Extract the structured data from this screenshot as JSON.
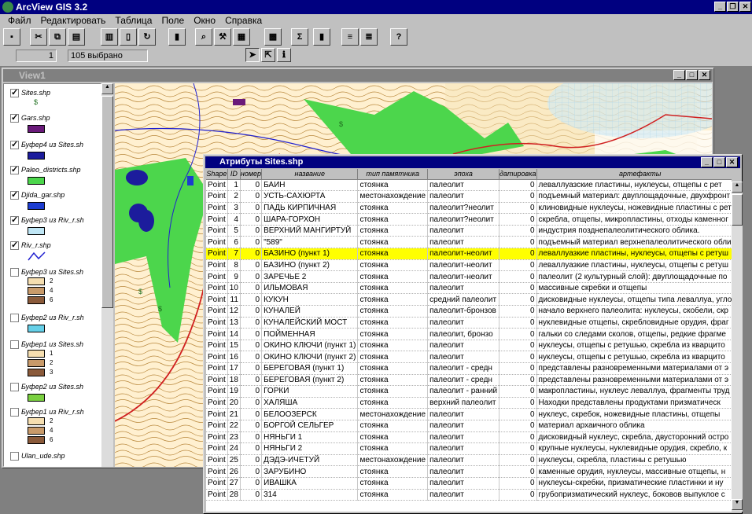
{
  "app": {
    "title": "ArcView GIS 3.2"
  },
  "menu": [
    "Файл",
    "Редактировать",
    "Таблица",
    "Поле",
    "Окно",
    "Справка"
  ],
  "status": {
    "selected_count": "1",
    "total_text": "105 выбрано"
  },
  "view": {
    "title": "View1"
  },
  "toc": [
    {
      "name": "Sites.shp",
      "checked": true
    },
    {
      "name": "Gars.shp",
      "checked": true,
      "color": "#6a1a7a"
    },
    {
      "name": "Буфер4 из Sites.sh",
      "checked": true,
      "color": "#1c1c9c"
    },
    {
      "name": "Paleo_districts.shp",
      "checked": true,
      "color": "#4cd64c"
    },
    {
      "name": "Djida_gar.shp",
      "checked": true,
      "color": "#1c3cd0"
    },
    {
      "name": "Буфер3 из Riv_r.sh",
      "checked": true,
      "color": "#bfe6f5"
    },
    {
      "name": "Riv_r.shp",
      "checked": true,
      "color": "#2020d0"
    },
    {
      "name": "Буфер3 из Sites.sh",
      "checked": false,
      "labels": [
        "2",
        "4",
        "6"
      ],
      "colors": [
        "#f5deb0",
        "#c89a6a",
        "#8a5a3a"
      ]
    },
    {
      "name": "Буфер2 из Riv_r.sh",
      "checked": false,
      "color": "#66d0e8"
    },
    {
      "name": "Буфер1 из Sites.sh",
      "checked": false,
      "labels": [
        "1",
        "2",
        "3"
      ],
      "colors": [
        "#f5deb0",
        "#c89a6a",
        "#8a5a3a"
      ]
    },
    {
      "name": "Буфер2 из Sites.sh",
      "checked": false,
      "color": "#7ad040"
    },
    {
      "name": "Буфер1 из Riv_r.sh",
      "checked": false,
      "labels": [
        "2",
        "4",
        "6"
      ],
      "colors": [
        "#f5deb0",
        "#c89a6a",
        "#8a5a3a"
      ]
    },
    {
      "name": "Ulan_ude.shp",
      "checked": false
    }
  ],
  "table": {
    "title": "Атрибуты Sites.shp",
    "columns": [
      "Shape",
      "ID",
      "номер",
      "название",
      "тип памятника",
      "эпоха",
      "датировка",
      "артефакты"
    ],
    "selected_index": 6,
    "rows": [
      [
        "Point",
        "1",
        "0",
        "БАИН",
        "стоянка",
        "палеолит",
        "0",
        "леваллуазские пластины, нуклеусы, отщепы с рет"
      ],
      [
        "Point",
        "2",
        "0",
        "УСТЬ-САХЮРТА",
        "местонахождение",
        "палеолит",
        "0",
        "подъемный материал: двуплощадочные, двухфронт"
      ],
      [
        "Point",
        "3",
        "0",
        "ПАДЬ КИРПИЧНАЯ",
        "стоянка",
        "палеолит?неолит",
        "0",
        "клиновидные нуклеусы, ножевидные пластины с ретуш"
      ],
      [
        "Point",
        "4",
        "0",
        "ШАРА-ГОРХОН",
        "стоянка",
        "палеолит?неолит",
        "0",
        "скребла, отщепы, микропластины, отходы каменног"
      ],
      [
        "Point",
        "5",
        "0",
        "ВЕРХНИЙ МАНГИРТУЙ",
        "стоянка",
        "палеолит",
        "0",
        "индустрия позднепалеолитического облика."
      ],
      [
        "Point",
        "6",
        "0",
        "\"589\"",
        "стоянка",
        "палеолит",
        "0",
        "подъемный материал верхнепалеолитического обли"
      ],
      [
        "Point",
        "7",
        "0",
        "БАЗИНО (пункт 1)",
        "стоянка",
        "палеолит-неолит",
        "0",
        "леваллуазкие пластины, нуклеусы, отщепы с ретуш"
      ],
      [
        "Point",
        "8",
        "0",
        "БАЗИНО (пункт 2)",
        "стоянка",
        "палеолит-неолит",
        "0",
        "леваллуазкие пластины, нуклеусы, отщепы с ретуш"
      ],
      [
        "Point",
        "9",
        "0",
        "ЗАРЕЧЬЕ 2",
        "стоянка",
        "палеолит-неолит",
        "0",
        "палеолит (2 культурный слой): двуплощадочные по"
      ],
      [
        "Point",
        "10",
        "0",
        "ИЛЬМОВАЯ",
        "стоянка",
        "палеолит",
        "0",
        "массивные скребки и отщепы"
      ],
      [
        "Point",
        "11",
        "0",
        "КУКУН",
        "стоянка",
        "средний палеолит",
        "0",
        "дисковидные нуклеусы, отщепы типа леваллуа, угло"
      ],
      [
        "Point",
        "12",
        "0",
        "КУНАЛЕЙ",
        "стоянка",
        "палеолит-бронзов",
        "0",
        "начало верхнего палеолита: нуклеусы, скобели, скр"
      ],
      [
        "Point",
        "13",
        "0",
        "КУНАЛЕЙСКИЙ МОСТ",
        "стоянка",
        "палеолит",
        "0",
        "нуклевидные отщепы, скребловидные орудия, фраг"
      ],
      [
        "Point",
        "14",
        "0",
        "ПОЙМЕННАЯ",
        "стоянка",
        "палеолит, бронзо",
        "0",
        "гальки со следами сколов, отщепы, редкие фрагме"
      ],
      [
        "Point",
        "15",
        "0",
        "ОКИНО КЛЮЧИ (пункт 1)",
        "стоянка",
        "палеолит",
        "0",
        "нуклеусы, отщепы с ретушью, скребла из кварцито"
      ],
      [
        "Point",
        "16",
        "0",
        "ОКИНО КЛЮЧИ (пункт 2)",
        "стоянка",
        "палеолит",
        "0",
        "нуклеусы, отщепы с ретушью, скребла из кварцито"
      ],
      [
        "Point",
        "17",
        "0",
        "БЕРЕГОВАЯ (пункт 1)",
        "стоянка",
        "палеолит - средн",
        "0",
        "представлены разновременными материалами от э"
      ],
      [
        "Point",
        "18",
        "0",
        "БЕРЕГОВАЯ (пункт 2)",
        "стоянка",
        "палеолит - средн",
        "0",
        "представлены разновременными материалами от э"
      ],
      [
        "Point",
        "19",
        "0",
        "ГОРКИ",
        "стоянка",
        "палеолит - ранний",
        "0",
        "макропластины, нуклеус леваллуа, фрагменты труд"
      ],
      [
        "Point",
        "20",
        "0",
        "ХАЛЯША",
        "стоянка",
        "верхний палеолит",
        "0",
        "Находки представлены продуктами призматическ"
      ],
      [
        "Point",
        "21",
        "0",
        "БЕЛООЗЕРСК",
        "местонахождение",
        "палеолит",
        "0",
        "нуклеус, скребок, ножевидные пластины, отщепы"
      ],
      [
        "Point",
        "22",
        "0",
        "БОРГОЙ СЕЛЬГЕР",
        "стоянка",
        "палеолит",
        "0",
        "материал архаичного облика"
      ],
      [
        "Point",
        "23",
        "0",
        "НЯНЬГИ 1",
        "стоянка",
        "палеолит",
        "0",
        "дисковидный нуклеус, скребла, двусторонний остро"
      ],
      [
        "Point",
        "24",
        "0",
        "НЯНЬГИ 2",
        "стоянка",
        "палеолит",
        "0",
        "крупные нуклеусы, нуклевидные орудия, скребло, к"
      ],
      [
        "Point",
        "25",
        "0",
        "ДЭДЭ-ИЧЕТУЙ",
        "местонахождение",
        "палеолит",
        "0",
        "нуклеусы, скребла, пластины с ретушью"
      ],
      [
        "Point",
        "26",
        "0",
        "ЗАРУБИНО",
        "стоянка",
        "палеолит",
        "0",
        "каменные орудия, нуклеусы, массивные отщепы, н"
      ],
      [
        "Point",
        "27",
        "0",
        "ИВАШКА",
        "стоянка",
        "палеолит",
        "0",
        "нуклеусы-скребки, призматические пластинки и ну"
      ],
      [
        "Point",
        "28",
        "0",
        "314",
        "стоянка",
        "палеолит",
        "0",
        "грубопризматический нуклеус, боковов выпуклое с"
      ]
    ]
  }
}
